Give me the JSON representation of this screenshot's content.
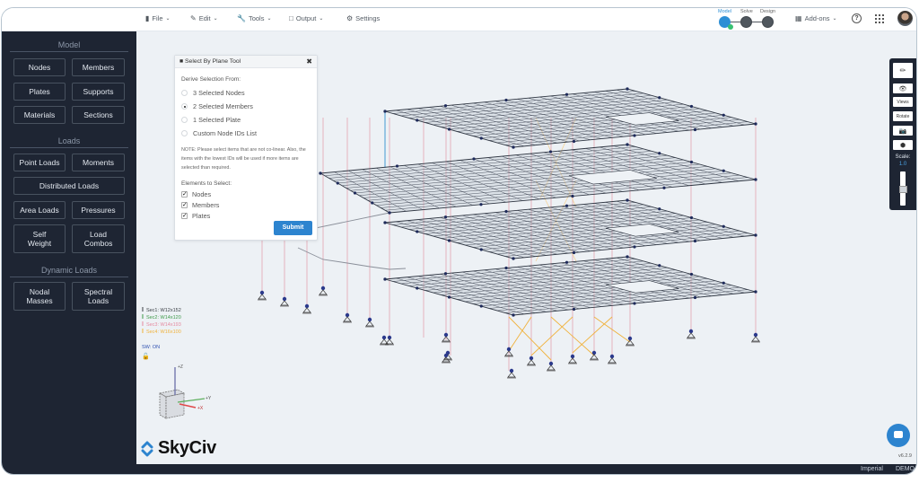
{
  "topbar": {
    "menus": [
      {
        "label": "File",
        "icon": "file-icon"
      },
      {
        "label": "Edit",
        "icon": "pencil-icon"
      },
      {
        "label": "Tools",
        "icon": "wrench-icon"
      },
      {
        "label": "Output",
        "icon": "monitor-icon"
      },
      {
        "label": "Settings",
        "icon": "gear-icon"
      }
    ],
    "workflow_steps": [
      {
        "label": "Model",
        "active": true
      },
      {
        "label": "Solve",
        "active": false
      },
      {
        "label": "Design",
        "active": false
      }
    ],
    "addons_label": "Add-ons",
    "help_label": "?"
  },
  "sidebar": {
    "sections": [
      {
        "title": "Model",
        "buttons": [
          "Nodes",
          "Members",
          "Plates",
          "Supports",
          "Materials",
          "Sections"
        ]
      },
      {
        "title": "Loads",
        "buttons": [
          "Point Loads",
          "Moments",
          "Distributed Loads",
          "Area Loads",
          "Pressures",
          "Self Weight",
          "Load Combos"
        ]
      },
      {
        "title": "Dynamic Loads",
        "buttons": [
          "Nodal Masses",
          "Spectral Loads"
        ]
      }
    ]
  },
  "panel": {
    "title": "Select By Plane Tool",
    "derive_label": "Derive Selection From:",
    "options": [
      {
        "label": "3 Selected Nodes",
        "selected": false
      },
      {
        "label": "2 Selected Members",
        "selected": true
      },
      {
        "label": "1 Selected Plate",
        "selected": false
      },
      {
        "label": "Custom Node IDs List",
        "selected": false
      }
    ],
    "note": "NOTE: Please select items that are not co-linear. Also, the items with the lowest IDs will be used if more items are selected than required.",
    "elements_label": "Elements to Select:",
    "elements": [
      {
        "label": "Nodes",
        "checked": true
      },
      {
        "label": "Members",
        "checked": true
      },
      {
        "label": "Plates",
        "checked": true
      }
    ],
    "submit_label": "Submit"
  },
  "legend": {
    "sections": [
      {
        "label": "Sec1: W12x152",
        "color": "#3a3f45"
      },
      {
        "label": "Sec2: W14x120",
        "color": "#3f9a4a"
      },
      {
        "label": "Sec3: W14x193",
        "color": "#e58aa0"
      },
      {
        "label": "Sec4: W16x100",
        "color": "#f0b23c"
      }
    ],
    "sw_status": "SW: ON"
  },
  "axes": {
    "z": "+Z",
    "y": "+Y",
    "x": "+X"
  },
  "toolbox": {
    "buttons": [
      "Views",
      "Rotate"
    ],
    "scale_label": "Scale:",
    "scale_value": "1.0"
  },
  "brand": {
    "name": "SkyCiv"
  },
  "status": {
    "version": "v6.2.9",
    "units": "Imperial",
    "mode": "DEMO"
  },
  "colors": {
    "accent": "#2d84cf",
    "sidebar_bg": "#1e2533",
    "canvas_bg": "#edf1f5"
  }
}
